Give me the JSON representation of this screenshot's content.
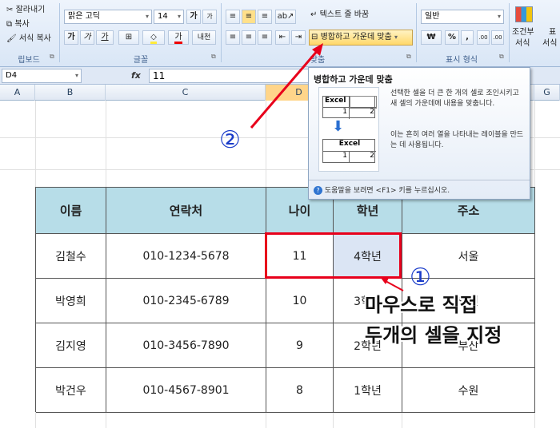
{
  "ribbon": {
    "clipboard": {
      "cut": "잘라내기",
      "copy": "복사",
      "format_painter": "서식 복사",
      "label": "립보드"
    },
    "font": {
      "name": "맑은 고딕",
      "size": "14",
      "grow": "가",
      "shrink": "가",
      "bold": "가",
      "italic": "가",
      "underline": "가",
      "color_a": "가",
      "phonetic": "내천",
      "label": "글꼴"
    },
    "align": {
      "wrap_text": "텍스트 줄 바꿈",
      "merge_center": "병합하고 가운데 맞춤",
      "label": "맞춤"
    },
    "number": {
      "format": "일반",
      "currency": "₩",
      "percent": "%",
      "comma": ",",
      "inc_decimal": ".00",
      "dec_decimal": ".00",
      "label": "표시 형식"
    },
    "styles": {
      "conditional_1": "조건부",
      "conditional_2": "서식",
      "table_1": "표",
      "table_2": "서식"
    }
  },
  "formula_bar": {
    "name_box": "D4",
    "fx": "fx",
    "value": "11"
  },
  "columns": [
    "A",
    "B",
    "C",
    "D",
    "E",
    "F",
    "G"
  ],
  "tooltip": {
    "title": "병합하고 가운데 맞춤",
    "desc": "선택한 셀을 더 큰 한 개의 셀로 조인시키고 새 셀의 가운데에 내용을 맞춥니다.",
    "desc2": "이는 흔히 여러 열을 나타내는 레이블을 만드는 데 사용됩니다.",
    "sample_top": "Excel",
    "sample_1": "1",
    "sample_2": "2",
    "sample_bottom": "Excel",
    "sample_b1": "1",
    "sample_b2": "2",
    "help": "도움말을 보려면 <F1> 키를 누르십시오."
  },
  "table": {
    "headers": [
      "이름",
      "연락처",
      "나이",
      "학년",
      "주소"
    ],
    "rows": [
      [
        "김철수",
        "010-1234-5678",
        "11",
        "4학년",
        "서울"
      ],
      [
        "박영희",
        "010-2345-6789",
        "10",
        "3학년",
        "인천"
      ],
      [
        "김지영",
        "010-3456-7890",
        "9",
        "2학년",
        "부산"
      ],
      [
        "박건우",
        "010-4567-8901",
        "8",
        "1학년",
        "수원"
      ]
    ]
  },
  "annotations": {
    "circle_1": "①",
    "circle_2": "②",
    "caption_line1": "마우스로 직접",
    "caption_line2": "두개의 셀을 지정"
  },
  "colors": {
    "header_fill": "#b7dde8",
    "highlight_red": "#e8001b",
    "ribbon_bg": "#dce8f6"
  }
}
